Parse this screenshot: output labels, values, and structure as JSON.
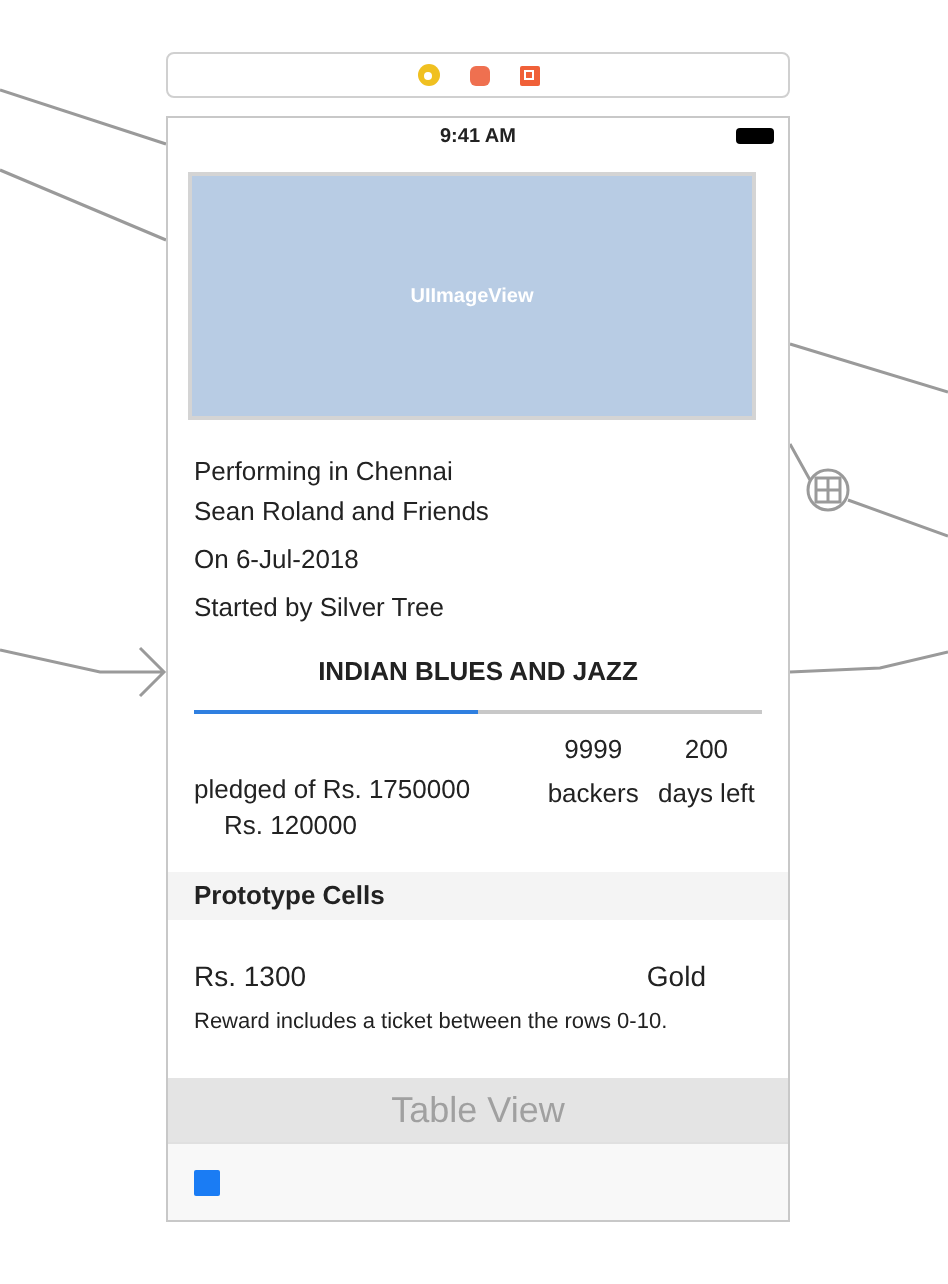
{
  "status_bar": {
    "time": "9:41 AM"
  },
  "image_view": {
    "label": "UIImageView"
  },
  "project": {
    "location": "Performing in Chennai",
    "artist": "Sean Roland and Friends",
    "date": "On 6-Jul-2018",
    "starter": "Started by Silver Tree",
    "title": "INDIAN BLUES AND JAZZ",
    "progress": {
      "level": 0.5
    },
    "pledged": "pledged of Rs. 1750000",
    "raised": "Rs. 120000",
    "backers_count": "9999",
    "backers_label": "backers",
    "days_count": "200",
    "days_label": "days left"
  },
  "table": {
    "section_header": "Prototype Cells",
    "cell": {
      "amount": "Rs. 1300",
      "tier": "Gold",
      "description": "Reward includes a ticket between the rows 0-10."
    },
    "overlay_title": "Table View"
  }
}
